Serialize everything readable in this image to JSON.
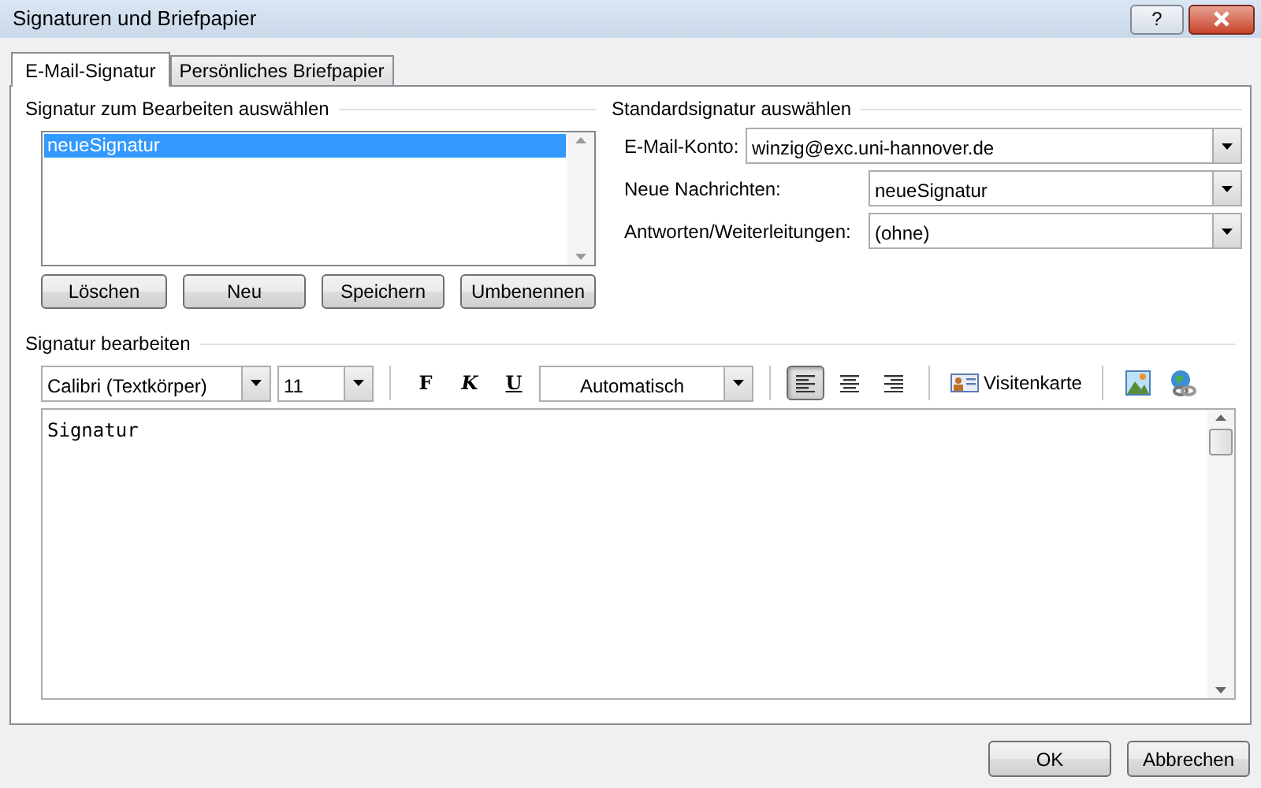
{
  "window": {
    "title": "Signaturen und Briefpapier",
    "help": "?"
  },
  "tabs": [
    {
      "label": "E-Mail-Signatur",
      "selected": true
    },
    {
      "label": "Persönliches Briefpapier",
      "selected": false
    }
  ],
  "select_section": {
    "title": "Signatur zum Bearbeiten auswählen",
    "signatures": [
      {
        "label": "neueSignatur",
        "selected": true
      }
    ],
    "buttons": [
      "Löschen",
      "Neu",
      "Speichern",
      "Umbenennen"
    ]
  },
  "default_section": {
    "title": "Standardsignatur auswählen",
    "fields": [
      {
        "label": "E-Mail-Konto:",
        "value": "winzig@exc.uni-hannover.de"
      },
      {
        "label": "Neue Nachrichten:",
        "value": "neueSignatur"
      },
      {
        "label": "Antworten/Weiterleitungen:",
        "value": "(ohne)"
      }
    ]
  },
  "edit_section": {
    "title": "Signatur bearbeiten",
    "font": "Calibri (Textkörper)",
    "size": "11",
    "format_buttons": [
      {
        "label": "F",
        "kind": "bold"
      },
      {
        "label": "K",
        "kind": "italic"
      },
      {
        "label": "U",
        "kind": "underline"
      }
    ],
    "color_setting": "Automatisch",
    "align_buttons": [
      {
        "kind": "left",
        "selected": true
      },
      {
        "kind": "center",
        "selected": false
      },
      {
        "kind": "right",
        "selected": false
      }
    ],
    "business_card": "Visitenkarte",
    "text": "Signatur"
  },
  "buttons": [
    "OK",
    "Abbrechen"
  ]
}
